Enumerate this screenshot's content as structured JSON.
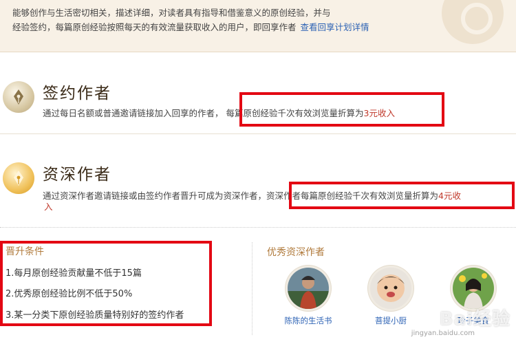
{
  "banner": {
    "line1": "能够创作与生活密切相关，描述详细，对读者具有指导和借鉴意义的原创经验，并与",
    "line2": "经验签约，每篇原创经验按照每天的有效流量获取收入的用户，即回享作者",
    "link": "查看回享计划详情"
  },
  "signed": {
    "title": "签约作者",
    "desc_prefix": "通过每日名额或普通邀请链接加入回享的作者，",
    "desc_main": "每篇原创经验千次有效浏览量折算为",
    "desc_highlight": "3元收入"
  },
  "senior": {
    "title": "资深作者",
    "desc_prefix": "通过资深作者邀请链接或由签约作者晋升可成为资深作者，",
    "desc_main": "资深作者每篇原创经验千次有效浏览量折算为",
    "desc_highlight": "4元收",
    "desc_wrap": "入"
  },
  "conditions": {
    "title": "晋升条件",
    "items": [
      "1.每月原创经验贡献量不低于15篇",
      "2.优秀原创经验比例不低于50%",
      "3.某一分类下原创经验质量特别好的签约作者"
    ]
  },
  "excellent": {
    "title": "优秀资深作者",
    "authors": [
      {
        "name": "陈陈的生活书"
      },
      {
        "name": "菩提小厨"
      },
      {
        "name": "玲子美食"
      }
    ]
  },
  "watermark": {
    "logo": "Bai经验",
    "url": "jingyan.baidu.com"
  },
  "colors": {
    "highlight": "#c0392b",
    "link": "#2c62b4",
    "annotation_box": "#e30713",
    "banner_bg": "#f8f1e6"
  }
}
